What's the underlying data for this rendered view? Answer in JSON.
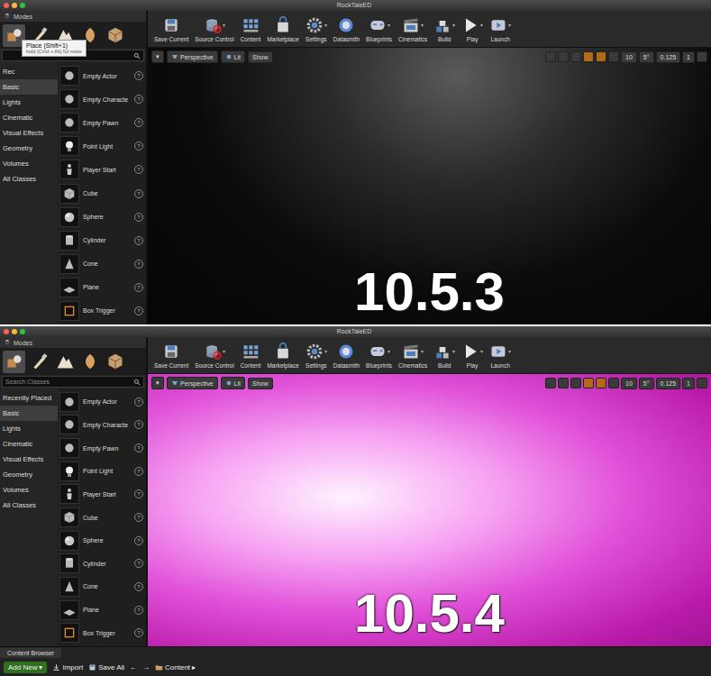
{
  "panels": [
    {
      "window": {
        "title": "RockTaleED"
      },
      "modes": {
        "title": "Modes",
        "tabs": [
          {
            "selected": true
          },
          {
            "selected": false
          },
          {
            "selected": false
          },
          {
            "selected": false
          },
          {
            "selected": false
          }
        ]
      },
      "tooltip": {
        "title": "Place (Shift+1)",
        "hint": "hold (Cmd + Alt) for more"
      },
      "search": {},
      "categories": [
        {
          "label": "Rec",
          "selected": false
        },
        {
          "label": "Basic",
          "selected": true
        },
        {
          "label": "Lights",
          "selected": false
        },
        {
          "label": "Cinematic",
          "selected": false
        },
        {
          "label": "Visual Effects",
          "selected": false
        },
        {
          "label": "Geometry",
          "selected": false
        },
        {
          "label": "Volumes",
          "selected": false
        },
        {
          "label": "All Classes",
          "selected": false
        }
      ],
      "items": [
        {
          "label": "Empty Actor"
        },
        {
          "label": "Empty Characte"
        },
        {
          "label": "Empty Pawn"
        },
        {
          "label": "Point Light"
        },
        {
          "label": "Player Start"
        },
        {
          "label": "Cube"
        },
        {
          "label": "Sphere"
        },
        {
          "label": "Cylinder"
        },
        {
          "label": "Cone"
        },
        {
          "label": "Plane"
        },
        {
          "label": "Box Trigger"
        }
      ],
      "help_glyph": "?",
      "toolbar": [
        {
          "label": "Save Current"
        },
        {
          "label": "Source Control",
          "menu": "▾"
        },
        {
          "label": "Content"
        },
        {
          "label": "Marketplace"
        },
        {
          "label": "Settings",
          "menu": "▾"
        },
        {
          "label": "Datasmith"
        },
        {
          "label": "Blueprints",
          "menu": "▾"
        },
        {
          "label": "Cinematics",
          "menu": "▾"
        },
        {
          "label": "Build",
          "menu": "▾"
        },
        {
          "label": "Play",
          "menu": "▾"
        },
        {
          "label": "Launch",
          "menu": "▾"
        }
      ],
      "viewport": {
        "kind": "dark",
        "menu": "▾",
        "view_mode": "Perspective",
        "lighting": "Lit",
        "show": "Show",
        "grid_snap": "10",
        "rotation_snap": "5°",
        "scale_snap": "0.125",
        "camera_speed": "1"
      },
      "overlay_label": "10.5.3"
    },
    {
      "window": {
        "title": "RockTaleED"
      },
      "modes": {
        "title": "Modes",
        "tabs": [
          {
            "selected": true
          },
          {
            "selected": false
          },
          {
            "selected": false
          },
          {
            "selected": false
          },
          {
            "selected": false
          }
        ]
      },
      "search": {
        "placeholder": "Search Classes"
      },
      "categories": [
        {
          "label": "Recently Placed",
          "selected": false
        },
        {
          "label": "Basic",
          "selected": true
        },
        {
          "label": "Lights",
          "selected": false
        },
        {
          "label": "Cinematic",
          "selected": false
        },
        {
          "label": "Visual Effects",
          "selected": false
        },
        {
          "label": "Geometry",
          "selected": false
        },
        {
          "label": "Volumes",
          "selected": false
        },
        {
          "label": "All Classes",
          "selected": false
        }
      ],
      "items": [
        {
          "label": "Empty Actor"
        },
        {
          "label": "Empty Characte"
        },
        {
          "label": "Empty Pawn"
        },
        {
          "label": "Point Light"
        },
        {
          "label": "Player Start"
        },
        {
          "label": "Cube"
        },
        {
          "label": "Sphere"
        },
        {
          "label": "Cylinder"
        },
        {
          "label": "Cone"
        },
        {
          "label": "Plane"
        },
        {
          "label": "Box Trigger"
        }
      ],
      "help_glyph": "?",
      "toolbar": [
        {
          "label": "Save Current"
        },
        {
          "label": "Source Control",
          "menu": "▾"
        },
        {
          "label": "Content"
        },
        {
          "label": "Marketplace"
        },
        {
          "label": "Settings",
          "menu": "▾"
        },
        {
          "label": "Datasmith"
        },
        {
          "label": "Blueprints",
          "menu": "▾"
        },
        {
          "label": "Cinematics",
          "menu": "▾"
        },
        {
          "label": "Build",
          "menu": "▾"
        },
        {
          "label": "Play",
          "menu": "▾"
        },
        {
          "label": "Launch",
          "menu": "▾"
        }
      ],
      "viewport": {
        "kind": "magenta",
        "menu": "▾",
        "view_mode": "Perspective",
        "lighting": "Lit",
        "show": "Show",
        "grid_snap": "10",
        "rotation_snap": "5°",
        "scale_snap": "0.125",
        "camera_speed": "1"
      },
      "overlay_label": "10.5.4",
      "content_browser": {
        "tab": "Content Browser",
        "add_new": "Add New",
        "add_menu": "▾",
        "import": "Import",
        "save_all": "Save All",
        "back": "←",
        "forward": "→",
        "path": "Content",
        "path_arrow": "▸"
      }
    }
  ]
}
